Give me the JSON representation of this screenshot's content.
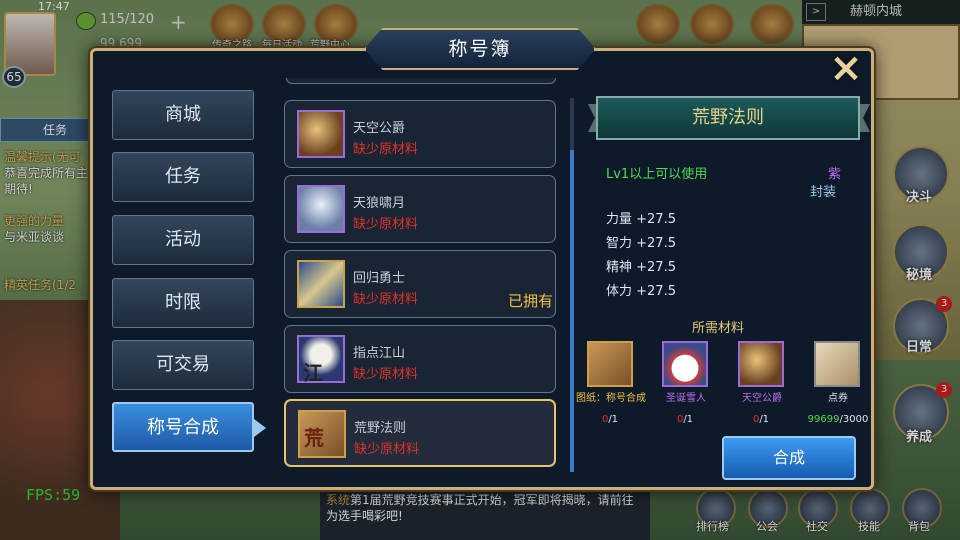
{
  "hud": {
    "time": "17:47",
    "level": "65",
    "stamina": "115/120",
    "gold": "99 699",
    "top_buttons": [
      "传奇之路",
      "每日活动",
      "荒野中心"
    ],
    "location": "赫顿内城"
  },
  "task_panel": {
    "tab_label": "任务",
    "lines": [
      "温馨提示(无可",
      "恭喜完成所有主",
      "期待!",
      "更强的力量",
      "与米亚谈谈",
      "精英任务(1/2"
    ]
  },
  "side_buttons": [
    {
      "label": "决斗",
      "badge": ""
    },
    {
      "label": "秘境",
      "badge": ""
    },
    {
      "label": "日常",
      "badge": "3"
    },
    {
      "label": "养成",
      "badge": "3"
    }
  ],
  "bottom_buttons": [
    "排行榜",
    "公会",
    "社交",
    "技能",
    "背包"
  ],
  "fps": "FPS:59",
  "news": {
    "tag": "系统",
    "text": "第1届荒野竞技赛事正式开始，冠军即将揭晓，请前往为选手喝彩吧!"
  },
  "modal": {
    "title": "称号簿",
    "close_icon": "×",
    "categories": [
      {
        "label": "商城",
        "active": false
      },
      {
        "label": "任务",
        "active": false
      },
      {
        "label": "活动",
        "active": false
      },
      {
        "label": "时限",
        "active": false
      },
      {
        "label": "可交易",
        "active": false
      },
      {
        "label": "称号合成",
        "active": true
      }
    ],
    "items": [
      {
        "name": "天空公爵",
        "status": "缺少原材料",
        "owned": "",
        "art": "eagle",
        "frame": "purple",
        "selected": false
      },
      {
        "name": "天狼啸月",
        "status": "缺少原材料",
        "owned": "",
        "art": "wolf",
        "frame": "purple",
        "selected": false
      },
      {
        "name": "回归勇士",
        "status": "缺少原材料",
        "owned": "已拥有",
        "art": "sword",
        "frame": "gold",
        "selected": false
      },
      {
        "name": "指点江山",
        "status": "缺少原材料",
        "owned": "",
        "art": "moon",
        "frame": "purple",
        "selected": false,
        "thumb_text": "江"
      },
      {
        "name": "荒野法则",
        "status": "缺少原材料",
        "owned": "",
        "art": "scroll",
        "frame": "gold",
        "selected": true,
        "thumb_text": "荒"
      }
    ],
    "detail": {
      "title": "荒野法则",
      "requirement": "Lv1以上可以使用",
      "quality": "紫",
      "binding": "封装",
      "stats": [
        "力量 +27.5",
        "智力 +27.5",
        "精神 +27.5",
        "体力 +27.5"
      ],
      "materials_title": "所需材料",
      "materials": [
        {
          "name": "图纸：称号合成",
          "have": "0",
          "need": "/1",
          "color": "gold",
          "art": "scroll"
        },
        {
          "name": "圣诞雪人",
          "have": "0",
          "need": "/1",
          "color": "purple",
          "art": "snow"
        },
        {
          "name": "天空公爵",
          "have": "0",
          "need": "/1",
          "color": "purple",
          "art": "eagle"
        },
        {
          "name": "点券",
          "have": "99699",
          "need": "/3000",
          "color": "gray",
          "art": "coupon"
        }
      ],
      "compose_label": "合成"
    }
  }
}
